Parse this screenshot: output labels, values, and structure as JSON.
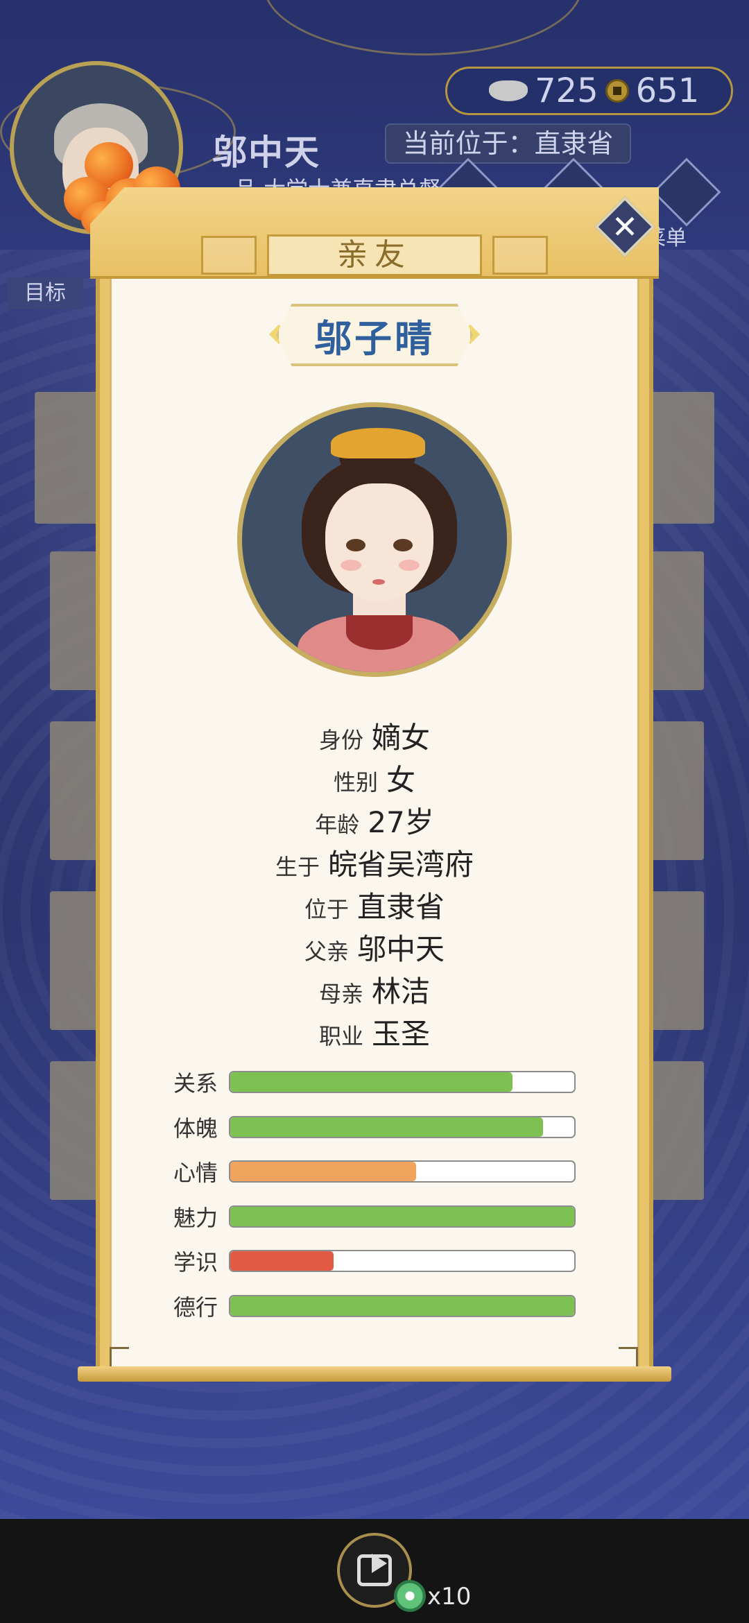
{
  "background": {
    "player_name": "邬中天",
    "player_title": "一品·大学士兼直隶总督",
    "location_text": "当前位于：直隶省",
    "currency": {
      "silver": "725",
      "coins": "651"
    },
    "goal_label": "目标",
    "menu_label": "菜单"
  },
  "modal": {
    "title": "亲友",
    "close_symbol": "✕",
    "character_name": "邬子晴",
    "info": [
      {
        "key": "身份",
        "value": "嫡女"
      },
      {
        "key": "性别",
        "value": "女"
      },
      {
        "key": "年龄",
        "value": "27岁"
      },
      {
        "key": "生于",
        "value": "皖省吴湾府"
      },
      {
        "key": "位于",
        "value": "直隶省"
      },
      {
        "key": "父亲",
        "value": "邬中天"
      },
      {
        "key": "母亲",
        "value": "林洁"
      },
      {
        "key": "职业",
        "value": "玉圣"
      }
    ],
    "stats": [
      {
        "label": "关系",
        "fill": 0.82,
        "color": "#7cc152"
      },
      {
        "label": "体魄",
        "fill": 0.91,
        "color": "#7cc152"
      },
      {
        "label": "心情",
        "fill": 0.54,
        "color": "#f0a45e"
      },
      {
        "label": "魅力",
        "fill": 1.0,
        "color": "#7cc152"
      },
      {
        "label": "学识",
        "fill": 0.3,
        "color": "#e25a43"
      },
      {
        "label": "德行",
        "fill": 1.0,
        "color": "#7cc152"
      }
    ]
  },
  "bottom": {
    "reward_count": "x10",
    "icons": [
      "share-icon",
      "jade-icon"
    ]
  }
}
